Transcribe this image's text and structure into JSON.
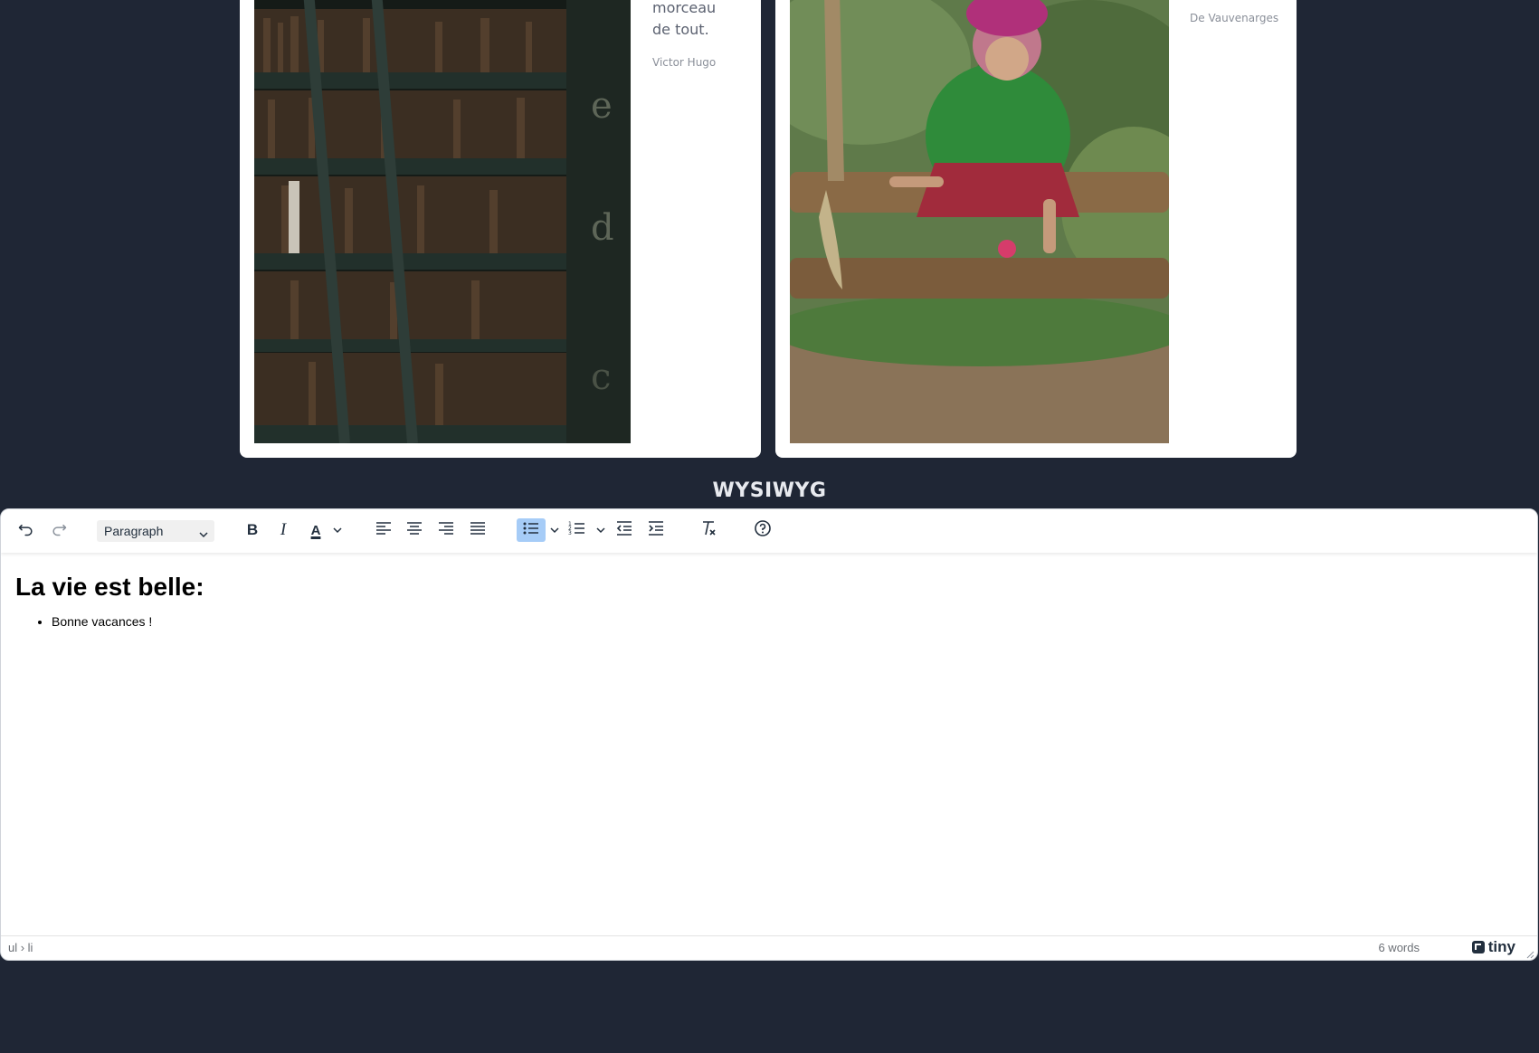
{
  "cards": [
    {
      "quote": "morceau de tout.",
      "author": "Victor Hugo",
      "photo_icon": "library-bookshelf-photo"
    },
    {
      "quote": "",
      "author": "De Vauvenarges",
      "photo_icon": "child-on-swing-photo"
    }
  ],
  "section_title": "WYSIWYG",
  "editor": {
    "toolbar": {
      "undo": "undo-icon",
      "redo": "redo-icon",
      "block_format": "Paragraph",
      "bold": "B",
      "italic": "I",
      "text_color_label": "A"
    },
    "content": {
      "heading": "La vie est belle:",
      "list_items": [
        "Bonne vacances !"
      ]
    },
    "statusbar": {
      "path": "ul › li",
      "word_count": "6 words",
      "brand": "tiny"
    }
  },
  "colors": {
    "background": "#1f2635",
    "active_button": "#a6ccf7"
  }
}
